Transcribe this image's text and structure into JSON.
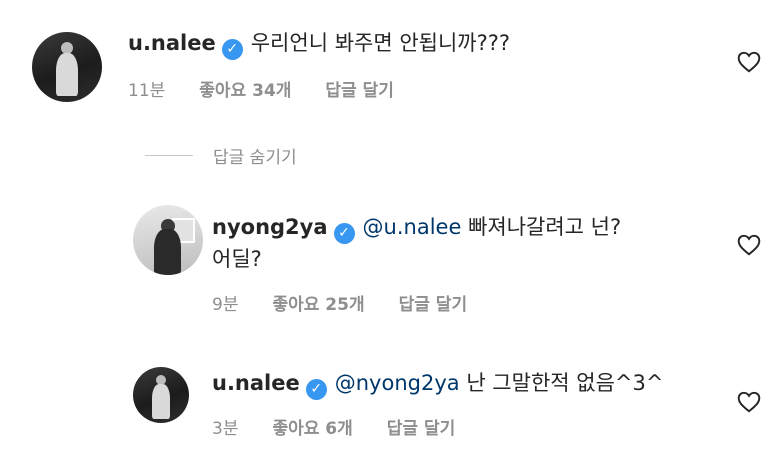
{
  "comments": [
    {
      "username": "u.nalee",
      "text": "우리언니 봐주면 안됩니까???",
      "time": "11분",
      "likes": "좋아요 34개",
      "reply": "답글 달기"
    },
    {
      "username": "nyong2ya",
      "mention": "@u.nalee",
      "text": "빠져나갈려고 넌?",
      "text_line2": "어딜?",
      "time": "9분",
      "likes": "좋아요 25개",
      "reply": "답글 달기"
    },
    {
      "username": "u.nalee",
      "mention": "@nyong2ya",
      "text": "난 그말한적 없음^3^",
      "time": "3분",
      "likes": "좋아요 6개",
      "reply": "답글 달기"
    }
  ],
  "hide_replies": "답글 숨기기",
  "icons": {
    "verified": "verified-badge-icon",
    "like": "heart-outline-icon"
  },
  "colors": {
    "verified": "#3897f0",
    "mention": "#00376b",
    "meta": "#8e8e8e"
  }
}
